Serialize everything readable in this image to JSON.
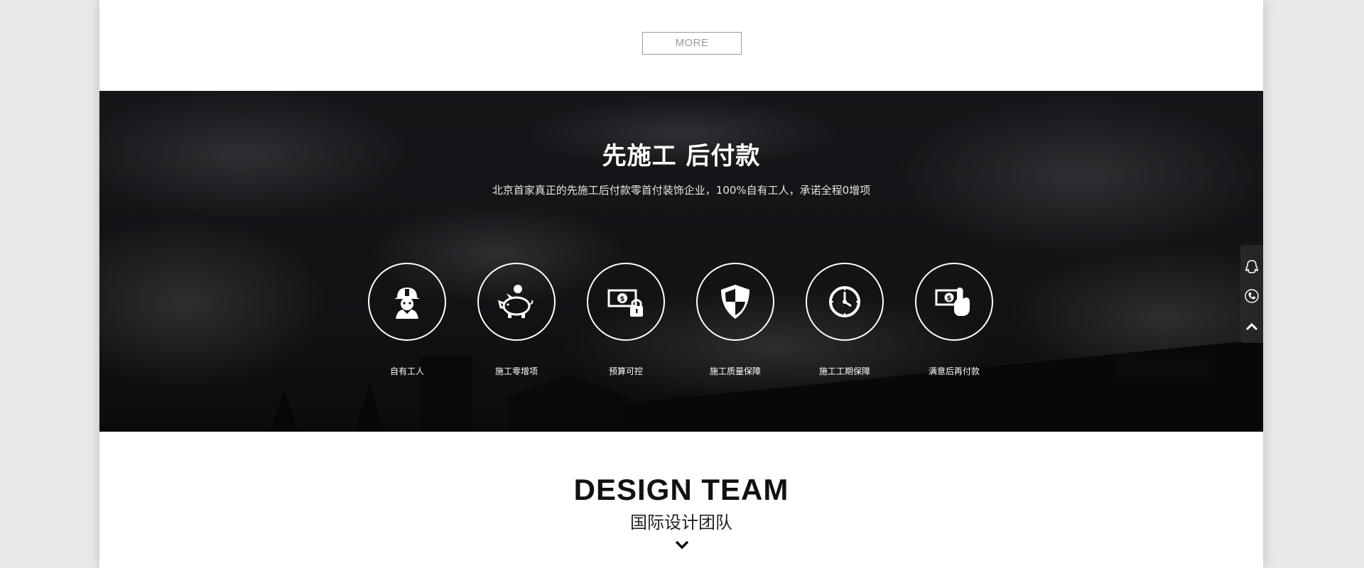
{
  "more_button": {
    "label": "MORE"
  },
  "banner": {
    "title": "先施工 后付款",
    "subtitle": "北京首家真正的先施工后付款零首付装饰企业，100%自有工人，承诺全程0增项",
    "features": [
      {
        "label": "自有工人",
        "icon": "worker-helmet-icon"
      },
      {
        "label": "施工零增项",
        "icon": "piggy-bank-icon"
      },
      {
        "label": "预算可控",
        "icon": "money-lock-icon"
      },
      {
        "label": "施工质量保障",
        "icon": "shield-icon"
      },
      {
        "label": "施工工期保障",
        "icon": "clock-icon"
      },
      {
        "label": "满意后再付款",
        "icon": "money-hand-icon"
      }
    ]
  },
  "side_widget": {
    "items": [
      {
        "icon": "qq-penguin-icon"
      },
      {
        "icon": "phone-icon"
      },
      {
        "icon": "chevron-up-icon"
      }
    ]
  },
  "team": {
    "title": "DESIGN TEAM",
    "subtitle": "国际设计团队",
    "arrow_icon": "chevron-down-icon"
  },
  "colors": {
    "banner_bg": "#121316",
    "banner_text": "#ffffff",
    "more_border": "#9a9a9a",
    "title_dark": "#111111"
  }
}
